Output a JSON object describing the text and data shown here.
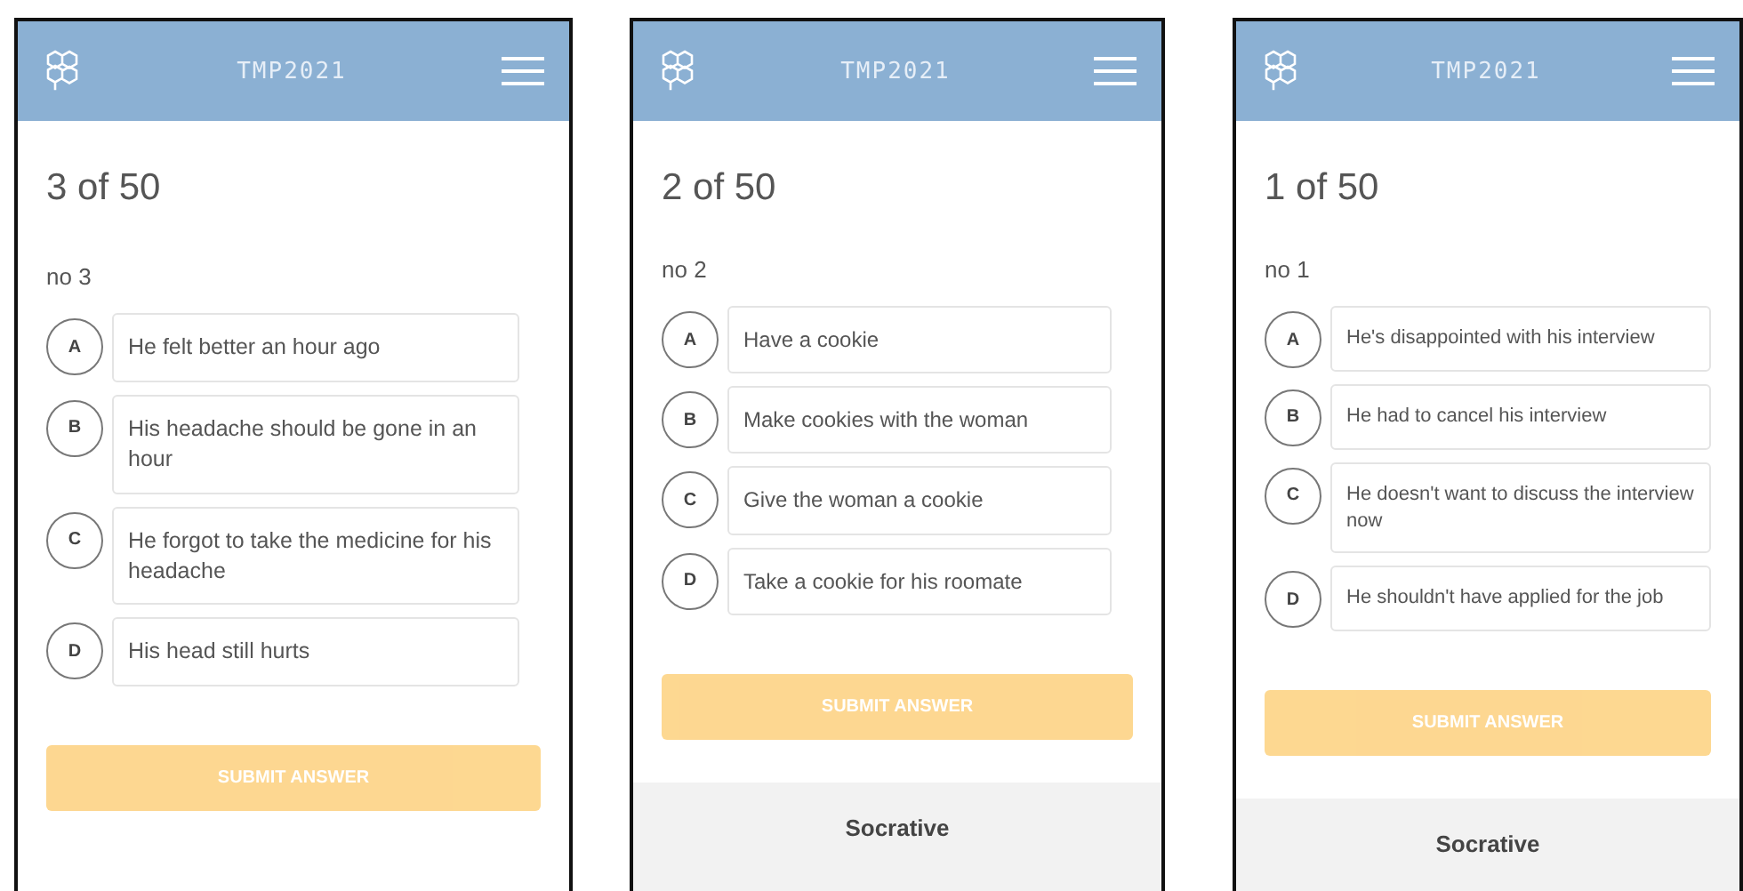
{
  "screens": [
    {
      "app_title": "TMP2021",
      "progress": "3 of 50",
      "question": "no 3",
      "options": [
        {
          "letter": "A",
          "text": "He felt better an hour ago",
          "selected": false
        },
        {
          "letter": "B",
          "text": "His headache should be gone in an hour",
          "selected": false
        },
        {
          "letter": "C",
          "text": "He forgot to take the medicine for his headache",
          "selected": false
        },
        {
          "letter": "D",
          "text": "His head still hurts",
          "selected": false
        }
      ],
      "submit": {
        "label": "SUBMIT ANSWER",
        "disabled": true
      }
    },
    {
      "app_title": "TMP2021",
      "progress": "2 of 50",
      "question": "no 2",
      "options": [
        {
          "letter": "A",
          "text": "Have a cookie",
          "selected": false
        },
        {
          "letter": "B",
          "text": "Make cookies with the woman",
          "selected": false
        },
        {
          "letter": "C",
          "text": "Give the woman a cookie",
          "selected": false
        },
        {
          "letter": "D",
          "text": "Take a cookie for his roomate",
          "selected": false
        }
      ],
      "submit": {
        "label": "SUBMIT ANSWER",
        "disabled": true
      },
      "footer": "Socrative"
    },
    {
      "app_title": "TMP2021",
      "progress": "1 of 50",
      "question": "no 1",
      "options": [
        {
          "letter": "A",
          "text": "He's disappointed with his interview",
          "selected": false
        },
        {
          "letter": "B",
          "text": "He had to cancel his interview",
          "selected": false
        },
        {
          "letter": "C",
          "text": "He doesn't want to discuss the interview now",
          "selected": false
        },
        {
          "letter": "D",
          "text": "He shouldn't have applied for the job",
          "selected": false
        }
      ],
      "submit": {
        "label": "SUBMIT ANSWER",
        "disabled": true
      },
      "footer": "Socrative"
    }
  ]
}
